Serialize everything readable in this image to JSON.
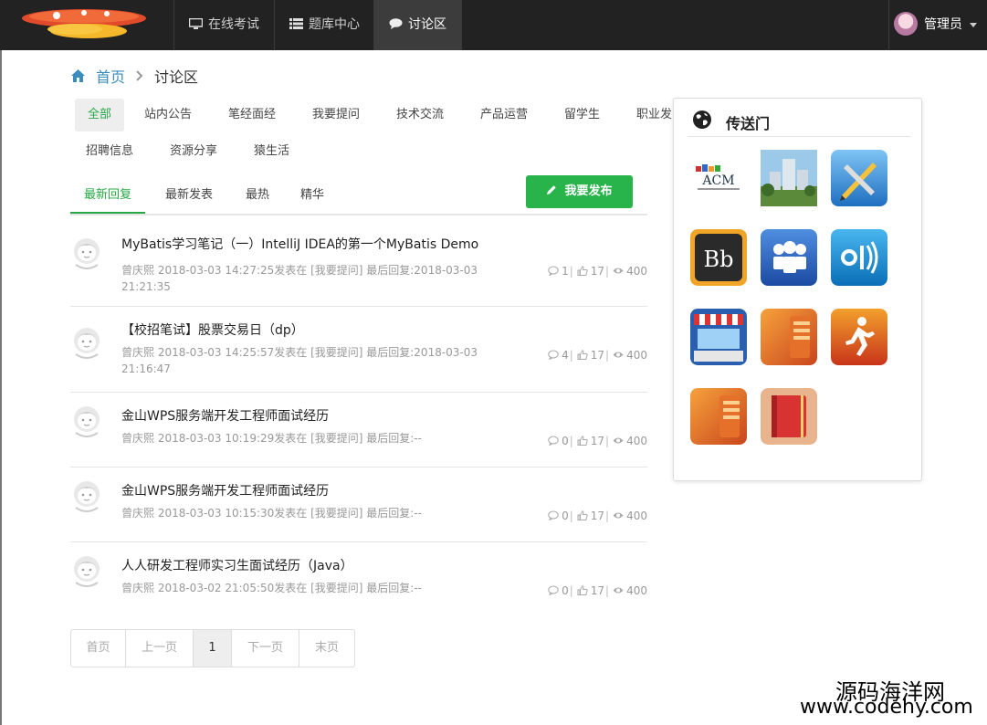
{
  "nav": {
    "items": [
      {
        "label": "在线考试",
        "icon": "monitor-icon"
      },
      {
        "label": "题库中心",
        "icon": "list-icon"
      },
      {
        "label": "讨论区",
        "icon": "comment-icon"
      }
    ],
    "user": "管理员"
  },
  "breadcrumb": {
    "home": "首页",
    "current": "讨论区"
  },
  "categories": [
    "全部",
    "站内公告",
    "笔经面经",
    "我要提问",
    "技术交流",
    "产品运营",
    "留学生",
    "职业发",
    "招聘信息",
    "资源分享",
    "猿生活"
  ],
  "sort_tabs": [
    "最新回复",
    "最新发表",
    "最热",
    "精华"
  ],
  "publish_label": "我要发布",
  "posts": [
    {
      "title": "MyBatis学习笔记（一）IntelliJ IDEA的第一个MyBatis Demo",
      "meta": "曾庆熙   2018-03-03 14:27:25发表在 [我要提问]    最后回复:2018-03-03 21:21:35",
      "comments": "1",
      "likes": "17",
      "views": "400"
    },
    {
      "title": "【校招笔试】股票交易日（dp）",
      "meta": "曾庆熙   2018-03-03 14:25:57发表在 [我要提问]    最后回复:2018-03-03 21:16:47",
      "comments": "4",
      "likes": "17",
      "views": "400"
    },
    {
      "title": "金山WPS服务端开发工程师面试经历",
      "meta": "曾庆熙   2018-03-03 10:19:29发表在 [我要提问]    最后回复:--",
      "comments": "0",
      "likes": "17",
      "views": "400"
    },
    {
      "title": "金山WPS服务端开发工程师面试经历",
      "meta": "曾庆熙   2018-03-03 10:15:30发表在 [我要提问]    最后回复:--",
      "comments": "0",
      "likes": "17",
      "views": "400"
    },
    {
      "title": "人人研发工程师实习生面试经历（Java）",
      "meta": "曾庆熙   2018-03-02 21:05:50发表在 [我要提问]    最后回复:--",
      "comments": "0",
      "likes": "17",
      "views": "400"
    }
  ],
  "pagination": [
    "首页",
    "上一页",
    "1",
    "下一页",
    "末页"
  ],
  "portal": {
    "title": "传送门",
    "apps": [
      "acm-logo",
      "campus-building",
      "pencil-ruler-app",
      "blackboard-app",
      "myspace-app",
      "aol-app",
      "store-app",
      "folder-app",
      "runner-app",
      "folder-app-2",
      "notebook-app"
    ],
    "acm_label": "ACM"
  },
  "watermark": {
    "line1": "源码海洋网",
    "line2": "www.codehy.com"
  },
  "colors": {
    "accent": "#28b44a",
    "link": "#3c8dbc",
    "navbar": "#222222"
  }
}
